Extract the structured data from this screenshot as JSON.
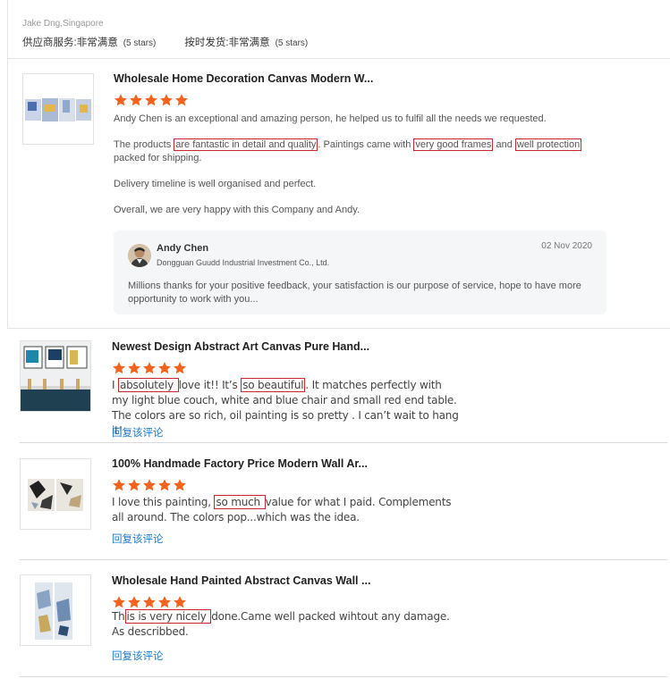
{
  "header": {
    "reviewer": "Jake Dng,Singapore",
    "supplier_service_label": "供应商服务: ",
    "supplier_service_value": "非常满意",
    "supplier_service_stars": "(5 stars)",
    "ontime_label": "按时发货: ",
    "ontime_value": "非常满意",
    "ontime_stars": "(5 stars)"
  },
  "colors": {
    "star": "#f4631e",
    "link": "#1f79c9",
    "highlight_border": "#c8282d"
  },
  "review1": {
    "title": "Wholesale Home Decoration Canvas Modern W...",
    "rating": 5,
    "para1": "Andy Chen is an exceptional and amazing person, he helped us to fulfil all the needs we requested.",
    "para2_a": "The products ",
    "para2_hl1": "are fantastic in detail and quality",
    "para2_b": ". Paintings came with ",
    "para2_hl2": "very good frames",
    "para2_c": " and ",
    "para2_hl3": "well protection ",
    "para2_d": "packed for shipping.",
    "para3": "Delivery timeline is well organised and perfect.",
    "para4": "Overall, we are very happy with this Company and Andy.",
    "reply": {
      "name": "Andy Chen",
      "company": "Dongguan Guudd Industrial Investment Co., Ltd.",
      "date": "02 Nov 2020",
      "text": "Millions thanks for your positive feedback, your satisfaction is our purpose of service, hope to have more opportunity to work with you..."
    }
  },
  "review2": {
    "title": "Newest Design Abstract Art Canvas Pure Hand...",
    "rating": 5,
    "t_a": "I ",
    "t_hl1": "absolutely ",
    "t_b": "love it!! It’s ",
    "t_hl2": "so beautiful",
    "t_c": ". It matches perfectly with my light blue couch, white and blue chair and small red end table. The colors are so rich, oil painting is so pretty . I can’t wait to hang it!",
    "reply_link": "回复该评论"
  },
  "review3": {
    "title": "100% Handmade Factory Price Modern Wall Ar...",
    "rating": 5,
    "t_a": "I love this painting, ",
    "t_hl1": "so much ",
    "t_b": "value for what I paid. Complements all around. The colors pop...which was the idea.",
    "reply_link": "回复该评论"
  },
  "review4": {
    "title": "Wholesale Hand Painted Abstract Canvas Wall ...",
    "rating": 5,
    "t_a": "Th",
    "t_hl1": "is is very nicely ",
    "t_b": "done.Came well packed wihtout any damage.",
    "t_c": "As describbed.",
    "reply_link": "回复该评论"
  }
}
